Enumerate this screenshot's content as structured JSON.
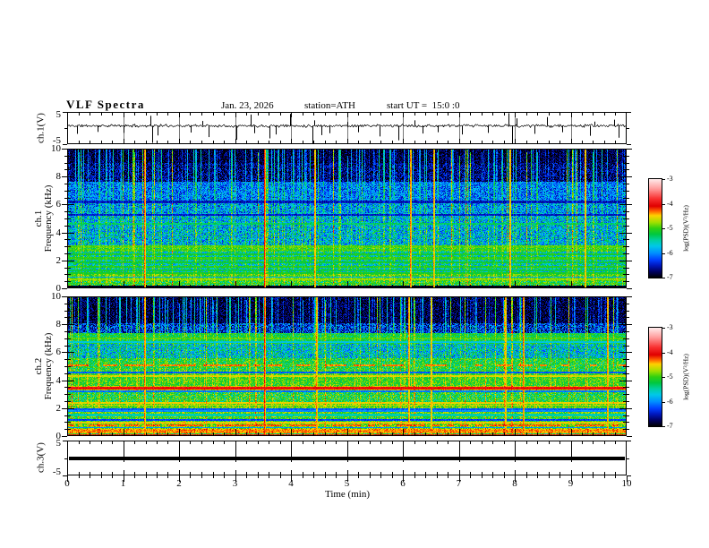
{
  "header": {
    "title": "VLF Spectra",
    "date": "Jan. 23, 2026",
    "station": "station=ATH",
    "start": "start UT =  15:0 :0"
  },
  "panels": {
    "ch1_wave": {
      "label": "ch.1(V)"
    },
    "ch1_spec": {
      "line1": "ch.1",
      "line2": "Frequency (kHz)"
    },
    "ch2_spec": {
      "line1": "ch.2",
      "line2": "Frequency (kHz)"
    },
    "ch3_wave": {
      "label": "ch.3(V)"
    }
  },
  "axes": {
    "x": {
      "label": "Time (min)",
      "range": [
        0,
        10
      ],
      "ticks": [
        0,
        1,
        2,
        3,
        4,
        5,
        6,
        7,
        8,
        9,
        10
      ],
      "minor_step": 0.2
    },
    "freq": {
      "range": [
        0,
        10
      ],
      "ticks": [
        0,
        2,
        4,
        6,
        8,
        10
      ],
      "minor_step": 0.5
    },
    "volt": {
      "range": [
        -5,
        5
      ],
      "ticks": [
        5,
        -5
      ]
    }
  },
  "colorbar": {
    "label": "log(PSD)(V²/Hz)",
    "ticks": [
      -3,
      -4,
      -5,
      -6,
      -7
    ],
    "range": [
      -7,
      -3
    ],
    "stops": [
      [
        -7.0,
        "#000000"
      ],
      [
        -6.76,
        "#000060"
      ],
      [
        -6.5,
        "#0018c0"
      ],
      [
        -6.28,
        "#0040ff"
      ],
      [
        -6.0,
        "#0090ff"
      ],
      [
        -5.72,
        "#00c8e8"
      ],
      [
        -5.48,
        "#00d0a0"
      ],
      [
        -5.24,
        "#00c840"
      ],
      [
        -5.0,
        "#30d010"
      ],
      [
        -4.76,
        "#a0e000"
      ],
      [
        -4.48,
        "#ffd000"
      ],
      [
        -4.3,
        "#ff6000"
      ],
      [
        -4.1,
        "#e00000"
      ],
      [
        -3.8,
        "#f83030"
      ],
      [
        -3.4,
        "#ff9a9a"
      ],
      [
        -3.0,
        "#ffecec"
      ]
    ]
  },
  "chart_data": [
    {
      "id": "ch1_waveform",
      "type": "line",
      "ylabel": "ch.1(V)",
      "x_range": [
        0,
        10
      ],
      "y_range": [
        -5,
        5
      ],
      "baseline": 0.7,
      "noise_amp": 0.55,
      "seed": 11,
      "spikes_down": [
        [
          0.18,
          -1.8
        ],
        [
          0.55,
          -1.2
        ],
        [
          1.0,
          -1.5
        ],
        [
          1.52,
          -4.6
        ],
        [
          1.62,
          -2.3
        ],
        [
          2.2,
          -1.4
        ],
        [
          2.52,
          -2.8
        ],
        [
          3.02,
          -3.6
        ],
        [
          3.35,
          -1.6
        ],
        [
          3.62,
          -3.2
        ],
        [
          3.72,
          -2.0
        ],
        [
          4.38,
          -4.8
        ],
        [
          4.55,
          -2.2
        ],
        [
          4.68,
          -1.6
        ],
        [
          5.2,
          -1.3
        ],
        [
          5.58,
          -2.6
        ],
        [
          5.92,
          -3.8
        ],
        [
          6.35,
          -1.7
        ],
        [
          6.62,
          -1.3
        ],
        [
          7.05,
          -2.0
        ],
        [
          7.52,
          -1.5
        ],
        [
          7.95,
          -4.9
        ],
        [
          8.35,
          -1.8
        ],
        [
          8.85,
          -1.3
        ],
        [
          9.35,
          -2.4
        ],
        [
          9.86,
          -3.0
        ]
      ],
      "spikes_up": [
        [
          1.48,
          3.8
        ],
        [
          2.42,
          2.2
        ],
        [
          3.28,
          4.2
        ],
        [
          3.98,
          4.4
        ],
        [
          4.42,
          2.4
        ],
        [
          5.0,
          1.9
        ],
        [
          6.2,
          2.4
        ],
        [
          7.88,
          4.6
        ],
        [
          8.04,
          3.0
        ],
        [
          8.58,
          3.4
        ],
        [
          9.42,
          2.0
        ],
        [
          9.78,
          2.6
        ]
      ]
    },
    {
      "id": "ch1_spectrogram",
      "type": "heatmap",
      "ylabel": "ch.1 Frequency (kHz)",
      "x_range": [
        0,
        10
      ],
      "y_range": [
        0,
        10
      ],
      "value_range": [
        -7,
        -3
      ],
      "seed": 21,
      "bands": [
        [
          9.0,
          10.01,
          -6.85,
          0.35,
          1.0
        ],
        [
          7.6,
          9.0,
          -6.7,
          0.45,
          1.0
        ],
        [
          6.3,
          7.6,
          -6.1,
          0.5,
          0.65
        ],
        [
          5.3,
          6.3,
          -5.95,
          0.6,
          0.6
        ],
        [
          3.1,
          5.3,
          -5.8,
          0.65,
          0.55
        ],
        [
          2.6,
          3.1,
          -5.15,
          0.45,
          0.35
        ],
        [
          1.05,
          2.6,
          -5.55,
          0.6,
          0.35
        ],
        [
          0.5,
          1.05,
          -5.0,
          0.3,
          0.25
        ],
        [
          0.18,
          0.5,
          -5.2,
          0.55,
          0.3
        ],
        [
          0.0,
          0.18,
          -6.95,
          0.08,
          0.05
        ]
      ],
      "h_lines": [
        [
          6.2,
          -6.55,
          0.08,
          0
        ],
        [
          5.25,
          -6.5,
          0.08,
          0
        ],
        [
          4.6,
          -5.35,
          0.06,
          0
        ],
        [
          3.0,
          -4.95,
          0.1,
          0
        ],
        [
          2.75,
          -5.0,
          0.08,
          0
        ],
        [
          2.45,
          -5.15,
          0.07,
          0
        ],
        [
          2.15,
          -5.05,
          0.07,
          0
        ],
        [
          1.85,
          -5.2,
          0.07,
          0
        ],
        [
          1.55,
          -5.1,
          0.07,
          0
        ],
        [
          1.3,
          -5.25,
          0.06,
          0
        ],
        [
          1.1,
          -5.15,
          0.06,
          0
        ],
        [
          0.8,
          -5.9,
          0.06,
          0
        ],
        [
          0.62,
          -4.8,
          0.06,
          0
        ],
        [
          0.35,
          -5.0,
          0.06,
          0
        ]
      ],
      "orange_streaks": [
        [
          1.38,
          1.0
        ],
        [
          3.52,
          1.4
        ],
        [
          4.42,
          0.8
        ],
        [
          6.12,
          0.9
        ],
        [
          6.55,
          0.7
        ],
        [
          7.9,
          0.8
        ],
        [
          9.25,
          0.7
        ]
      ]
    },
    {
      "id": "ch2_spectrogram",
      "type": "heatmap",
      "ylabel": "ch.2 Frequency (kHz)",
      "x_range": [
        0,
        10
      ],
      "y_range": [
        0,
        10
      ],
      "value_range": [
        -7,
        -3
      ],
      "seed": 31,
      "bands": [
        [
          8.1,
          10.01,
          -6.85,
          0.4,
          1.0
        ],
        [
          7.4,
          8.1,
          -6.4,
          0.6,
          0.85
        ],
        [
          6.6,
          7.4,
          -5.25,
          0.35,
          0.3
        ],
        [
          5.6,
          6.6,
          -5.7,
          0.65,
          0.4
        ],
        [
          4.7,
          5.6,
          -5.2,
          0.45,
          0.3
        ],
        [
          3.6,
          4.7,
          -5.05,
          0.35,
          0.25
        ],
        [
          3.25,
          3.6,
          -4.7,
          0.35,
          0.2
        ],
        [
          2.4,
          3.25,
          -5.2,
          0.5,
          0.3
        ],
        [
          1.35,
          2.4,
          -4.95,
          0.4,
          0.2
        ],
        [
          0.9,
          1.35,
          -5.15,
          0.45,
          0.25
        ],
        [
          0.52,
          0.9,
          -4.9,
          0.4,
          0.2
        ],
        [
          0.22,
          0.52,
          -4.45,
          0.25,
          0.15
        ],
        [
          0.06,
          0.22,
          -5.3,
          0.4,
          0.2
        ],
        [
          0.0,
          0.06,
          -6.9,
          0.08,
          0.0
        ]
      ],
      "h_lines": [
        [
          7.0,
          -4.95,
          0.07,
          0
        ],
        [
          6.72,
          -5.7,
          0.06,
          0
        ],
        [
          5.05,
          -4.35,
          0.07,
          1
        ],
        [
          4.55,
          -6.2,
          0.06,
          0
        ],
        [
          4.3,
          -4.6,
          0.06,
          0
        ],
        [
          3.42,
          -4.05,
          0.09,
          0
        ],
        [
          3.2,
          -6.1,
          0.06,
          0
        ],
        [
          2.35,
          -4.55,
          0.07,
          0
        ],
        [
          2.2,
          -4.7,
          0.05,
          0
        ],
        [
          1.95,
          -6.2,
          0.06,
          0
        ],
        [
          1.8,
          -6.0,
          0.05,
          0
        ],
        [
          1.5,
          -5.55,
          0.12,
          0
        ],
        [
          1.15,
          -6.3,
          0.06,
          0
        ],
        [
          0.95,
          -4.55,
          0.06,
          0
        ],
        [
          0.75,
          -4.3,
          0.06,
          1
        ],
        [
          0.62,
          -6.0,
          0.05,
          0
        ],
        [
          0.4,
          -4.35,
          0.08,
          0
        ],
        [
          0.1,
          -4.15,
          0.05,
          0
        ]
      ],
      "orange_streaks": [
        [
          1.38,
          0.9
        ],
        [
          3.52,
          1.3
        ],
        [
          4.45,
          0.8
        ],
        [
          6.1,
          0.8
        ],
        [
          6.5,
          0.6
        ],
        [
          7.82,
          0.7
        ],
        [
          8.15,
          1.0
        ],
        [
          9.65,
          0.8
        ]
      ]
    },
    {
      "id": "ch3_waveform",
      "type": "line",
      "ylabel": "ch.3(V)",
      "x_range": [
        0,
        10
      ],
      "y_range": [
        -5,
        5
      ],
      "constant_value": 0,
      "line_thickness_px": 4,
      "seed": 41
    }
  ]
}
